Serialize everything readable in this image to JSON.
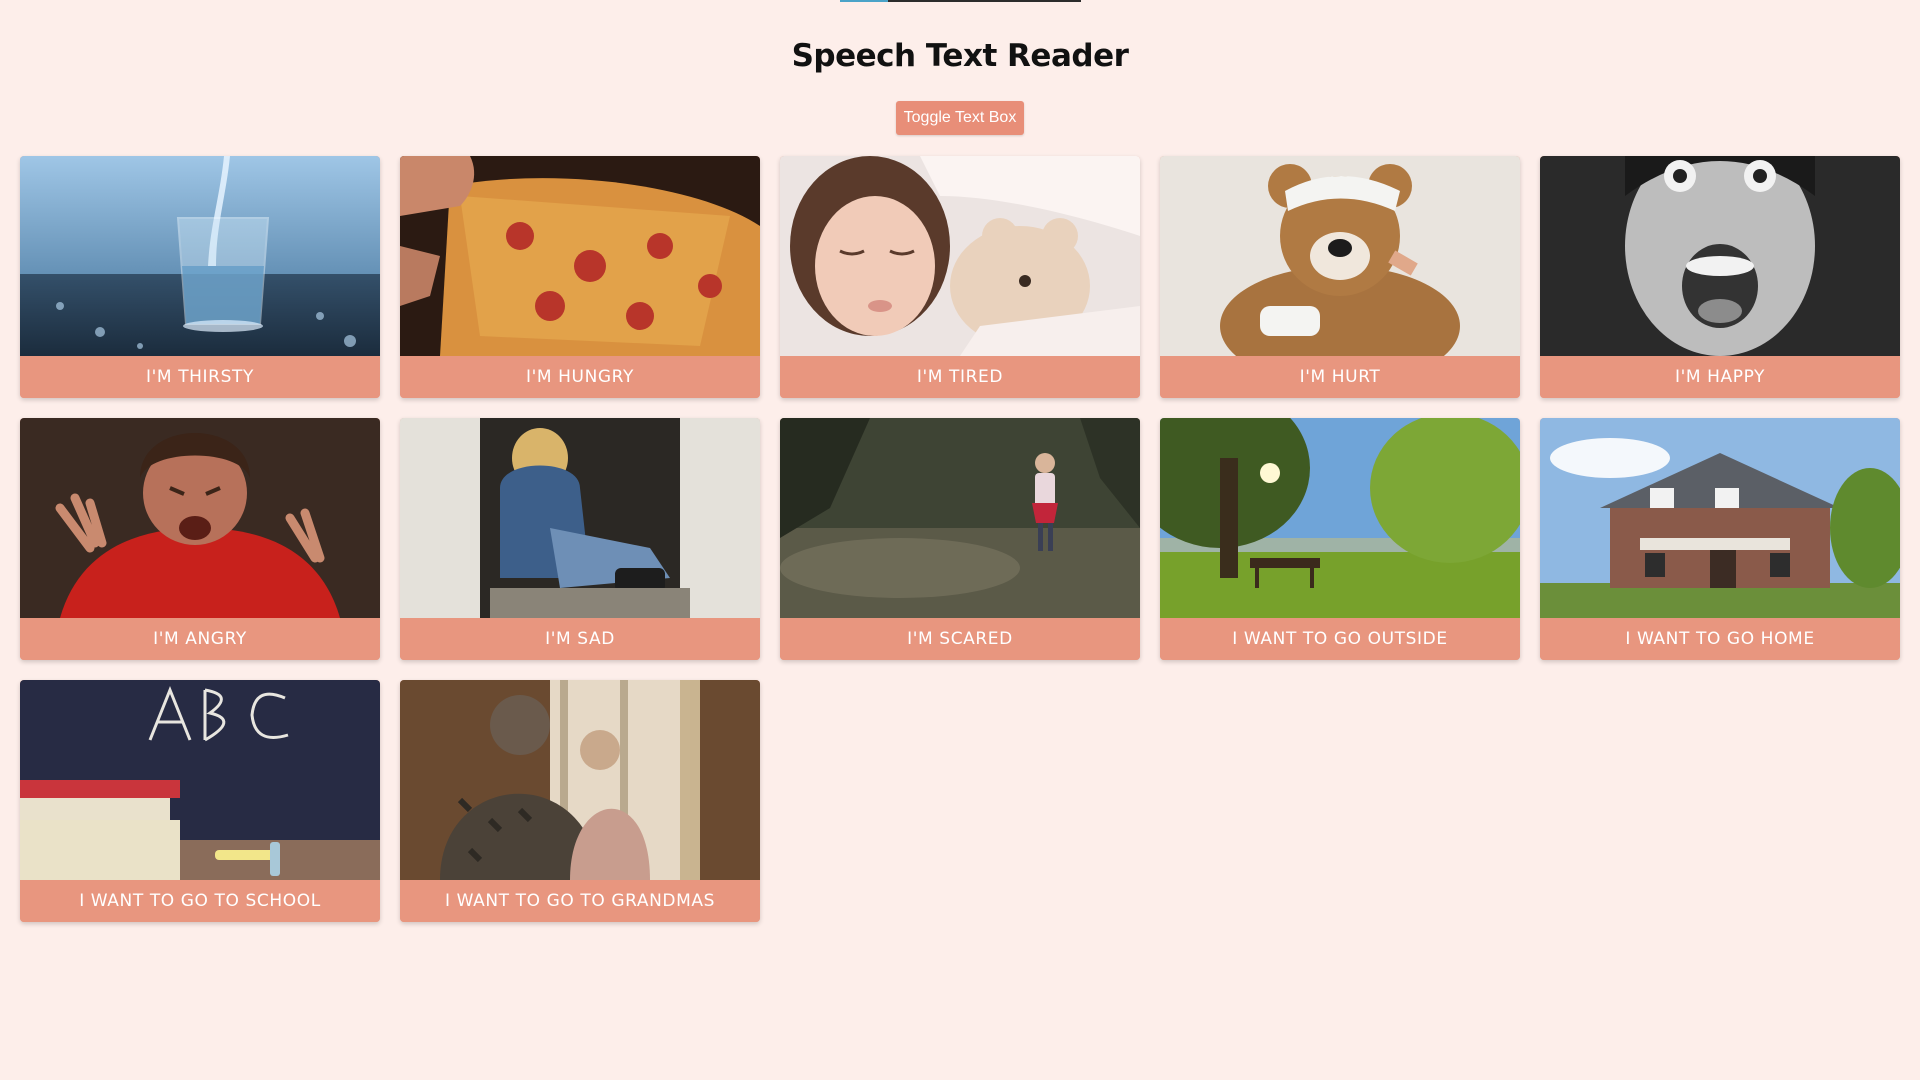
{
  "header": {
    "title": "Speech Text Reader",
    "toggle_label": "Toggle Text Box",
    "progress": 0.2
  },
  "cards": [
    {
      "label": "I'M THIRSTY",
      "image": "glass-of-water"
    },
    {
      "label": "I'M HUNGRY",
      "image": "pizza-slice"
    },
    {
      "label": "I'M TIRED",
      "image": "sleeping-child-with-teddy"
    },
    {
      "label": "I'M HURT",
      "image": "bandaged-teddy-bear"
    },
    {
      "label": "I'M HAPPY",
      "image": "excited-boy"
    },
    {
      "label": "I'M ANGRY",
      "image": "angry-boy"
    },
    {
      "label": "I'M SAD",
      "image": "sad-girl-in-doorway"
    },
    {
      "label": "I'M SCARED",
      "image": "small-girl-in-forest"
    },
    {
      "label": "I WANT TO GO OUTSIDE",
      "image": "sunny-park"
    },
    {
      "label": "I WANT TO GO HOME",
      "image": "house"
    },
    {
      "label": "I WANT TO GO TO SCHOOL",
      "image": "chalkboard-abc"
    },
    {
      "label": "I WANT TO GO TO GRANDMAS",
      "image": "grandma-with-child"
    }
  ],
  "colors": {
    "background": "#fdeeea",
    "accent": "#e8967f",
    "button": "#e88e78"
  }
}
